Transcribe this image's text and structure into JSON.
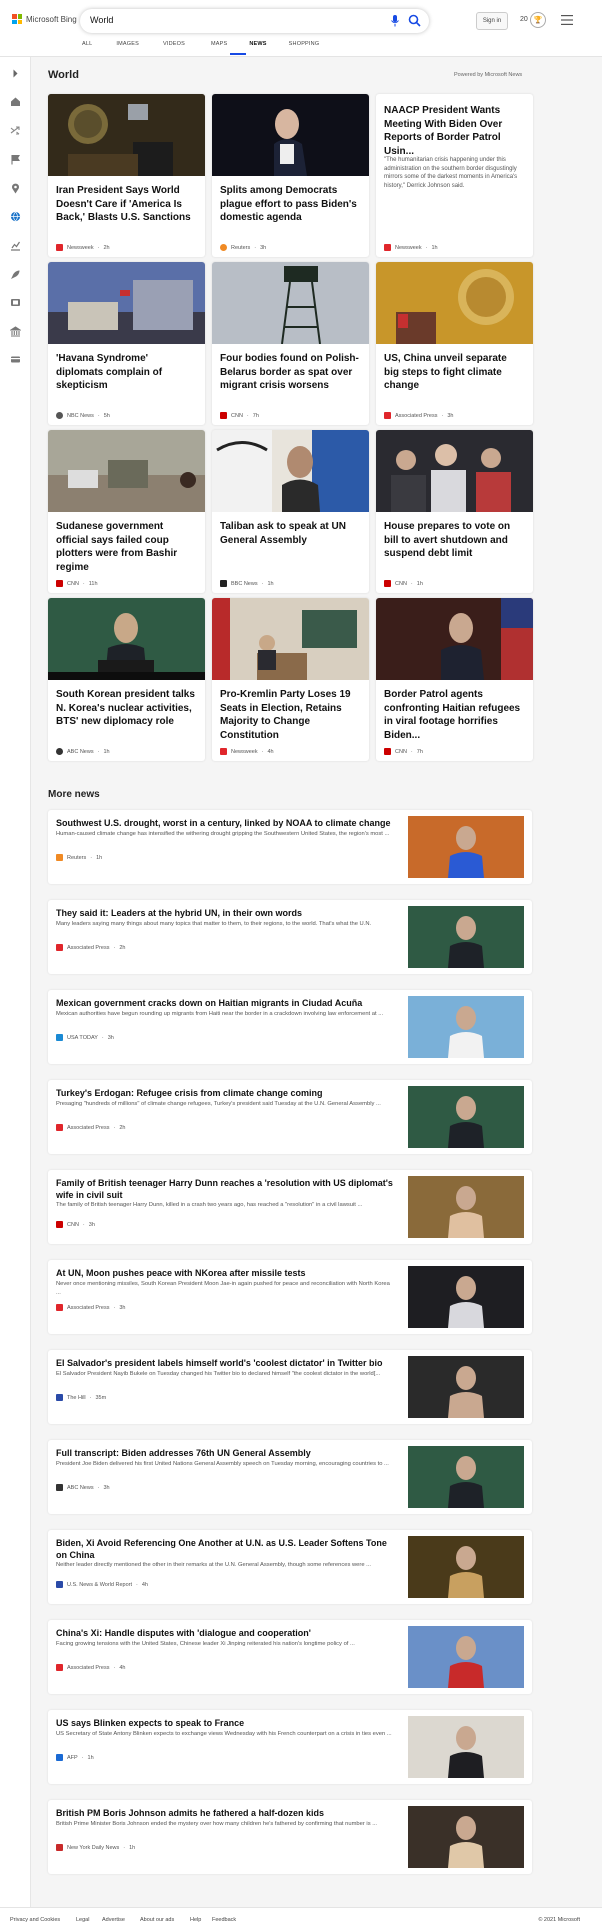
{
  "brand": {
    "name": "Microsoft Bing"
  },
  "search": {
    "value": "World"
  },
  "header": {
    "signin_label": "Sign in",
    "points": "20"
  },
  "tabs": [
    {
      "label": "ALL"
    },
    {
      "label": "IMAGES"
    },
    {
      "label": "VIDEOS"
    },
    {
      "label": "MAPS"
    },
    {
      "label": "NEWS"
    },
    {
      "label": "SHOPPING"
    }
  ],
  "sidebar": {
    "icons": [
      "chevron-right-icon",
      "home-icon",
      "shuffle-icon",
      "flag-icon",
      "location-icon",
      "globe-icon",
      "chart-icon",
      "rocket-icon",
      "film-icon",
      "bank-icon",
      "card-icon"
    ]
  },
  "world": {
    "title": "World",
    "powered": "Powered by Microsoft News",
    "cards": [
      {
        "title": "Iran President Says World Doesn't Care if 'America Is Back,' Blasts U.S. Sanctions",
        "source": "Newsweek",
        "time": "2h"
      },
      {
        "title": "Splits among Democrats plague effort to pass Biden's domestic agenda",
        "source": "Reuters",
        "time": "3h"
      },
      {
        "title": "NAACP President Wants Meeting With Biden Over Reports of Border Patrol Usin...",
        "snippet": "\"The humanitarian crisis happening under this administration on the southern border disgustingly mirrors some of the darkest moments in America's history,\" Derrick Johnson said.",
        "source": "Newsweek",
        "time": "1h"
      },
      {
        "title": "'Havana Syndrome' diplomats complain of skepticism",
        "source": "NBC News",
        "time": "5h"
      },
      {
        "title": "Four bodies found on Polish-Belarus border as spat over migrant crisis worsens",
        "source": "CNN",
        "time": "7h"
      },
      {
        "title": "US, China unveil separate big steps to fight climate change",
        "source": "Associated Press",
        "time": "3h"
      },
      {
        "title": "Sudanese government official says failed coup plotters were from Bashir regime",
        "source": "CNN",
        "time": "11h"
      },
      {
        "title": "Taliban ask to speak at UN General Assembly",
        "source": "BBC News",
        "time": "1h"
      },
      {
        "title": "House prepares to vote on bill to avert shutdown and suspend debt limit",
        "source": "CNN",
        "time": "1h"
      },
      {
        "title": "South Korean president talks N. Korea's nuclear activities, BTS' new diplomacy role",
        "source": "ABC News",
        "time": "1h"
      },
      {
        "title": "Pro-Kremlin Party Loses 19 Seats in Election, Retains Majority to Change Constitution",
        "source": "Newsweek",
        "time": "4h"
      },
      {
        "title": "Border Patrol agents confronting Haitian refugees in viral footage horrifies Biden...",
        "source": "CNN",
        "time": "7h"
      }
    ]
  },
  "more": {
    "title": "More news",
    "items": [
      {
        "title": "Southwest U.S. drought, worst in a century, linked by NOAA to climate change",
        "snippet": "Human-caused climate change has intensified the withering drought gripping the Southwestern United States, the region's most ...",
        "source": "Reuters",
        "time": "1h"
      },
      {
        "title": "They said it: Leaders at the hybrid UN, in their own words",
        "snippet": "Many leaders saying many things about many topics that matter to them, to their regions, to the world. That's what the U.N.",
        "source": "Associated Press",
        "time": "2h"
      },
      {
        "title": "Mexican government cracks down on Haitian migrants in Ciudad Acuña",
        "snippet": "Mexican authorities have begun rounding up migrants from Haiti near the border in a crackdown involving law enforcement at ...",
        "source": "USA TODAY",
        "time": "3h"
      },
      {
        "title": "Turkey's Erdogan: Refugee crisis from climate change coming",
        "snippet": "Presaging \"hundreds of millions\" of climate change refugees, Turkey's president said Tuesday at the U.N. General Assembly ...",
        "source": "Associated Press",
        "time": "2h"
      },
      {
        "title": "Family of British teenager Harry Dunn reaches a 'resolution with US diplomat's wife in civil suit",
        "snippet": "The family of British teenager Harry Dunn, killed in a crash two years ago, has reached a \"resolution\" in a civil lawsuit ...",
        "source": "CNN",
        "time": "3h"
      },
      {
        "title": "At UN, Moon pushes peace with NKorea after missile tests",
        "snippet": "Never once mentioning missiles, South Korean President Moon Jae-in again pushed for peace and reconciliation with North Korea ...",
        "source": "Associated Press",
        "time": "3h"
      },
      {
        "title": "El Salvador's president labels himself world's 'coolest dictator' in Twitter bio",
        "snippet": "El Salvador President Nayib Bukele on Tuesday changed his Twitter bio to declared himself \"the coolest dictator in the world[...",
        "source": "The Hill",
        "time": "35m"
      },
      {
        "title": "Full transcript: Biden addresses 76th UN General Assembly",
        "snippet": "President Joe Biden delivered his first United Nations General Assembly speech on Tuesday morning, encouraging countries to ...",
        "source": "ABC News",
        "time": "3h"
      },
      {
        "title": "Biden, Xi Avoid Referencing One Another at U.N. as U.S. Leader Softens Tone on China",
        "snippet": "Neither leader directly mentioned the other in their remarks at the U.N. General Assembly, though some references were ...",
        "source": "U.S. News & World Report",
        "time": "4h"
      },
      {
        "title": "China's Xi: Handle disputes with 'dialogue and cooperation'",
        "snippet": "Facing growing tensions with the United States, Chinese leader Xi Jinping reiterated his nation's longtime policy of ...",
        "source": "Associated Press",
        "time": "4h"
      },
      {
        "title": "US says Blinken expects to speak to France",
        "snippet": "US Secretary of State Antony Blinken expects to exchange views Wednesday with his French counterpart on a crisis in ties even ...",
        "source": "AFP",
        "time": "1h"
      },
      {
        "title": "British PM Boris Johnson admits he fathered a half-dozen kids",
        "snippet": "British Prime Minister Boris Johnson ended the mystery over how many children he's fathered by confirming that number is ...",
        "source": "New York Daily News",
        "time": "1h"
      }
    ]
  },
  "footer": {
    "links": [
      "Privacy and Cookies",
      "Legal",
      "Advertise",
      "About our ads",
      "Help",
      "Feedback"
    ],
    "copyright": "© 2021 Microsoft"
  },
  "colors": {
    "accent": "#174ae4",
    "newsweek": "#e0262b",
    "cnn": "#cc0000",
    "ap": "#e0262b"
  }
}
